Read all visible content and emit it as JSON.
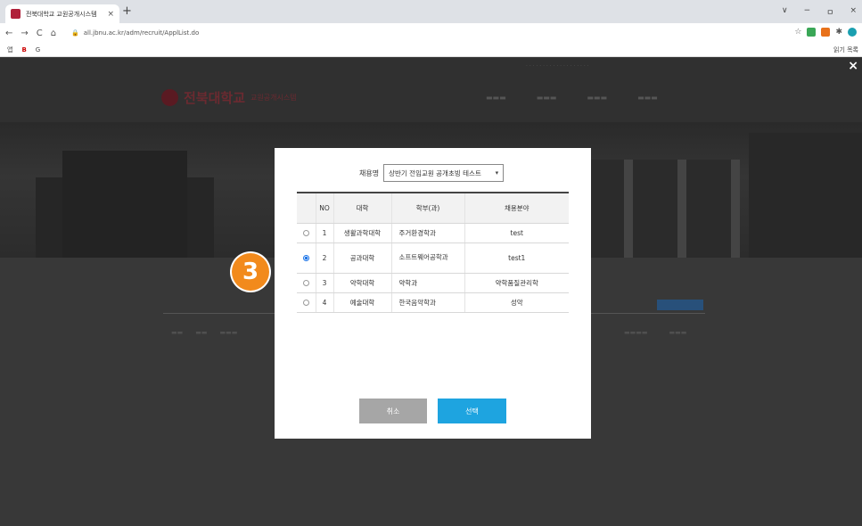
{
  "browser": {
    "tab_title": "전북대학교 교원공개시스템",
    "tab_close": "×",
    "new_tab": "+",
    "window_controls": [
      "∨",
      "−",
      "ㅁ",
      "×"
    ],
    "nav": [
      "←",
      "→",
      "C",
      "⌂"
    ],
    "url": "all.jbnu.ac.kr/adm/recruit/ApplList.do",
    "bookmarks": [
      "앱",
      "B",
      "G"
    ],
    "reading_list": "읽기 목록"
  },
  "page": {
    "university": "전북대학교",
    "system_name": "교원공개시스템",
    "close": "×"
  },
  "step_badge": "3",
  "modal": {
    "recruit_label": "채용명",
    "recruit_value": "상반기 전임교원 공개초빙 테스트",
    "table": {
      "headers": [
        "",
        "NO",
        "대학",
        "학부(과)",
        "채용분야"
      ],
      "rows": [
        {
          "selected": false,
          "no": "1",
          "college": "생활과학대학",
          "dept": "주거환경학과",
          "field": "test"
        },
        {
          "selected": true,
          "no": "2",
          "college": "공과대학",
          "dept": "소프트웨어공학과",
          "field": "test1"
        },
        {
          "selected": false,
          "no": "3",
          "college": "약학대학",
          "dept": "약학과",
          "field": "약학품질관리학"
        },
        {
          "selected": false,
          "no": "4",
          "college": "예술대학",
          "dept": "한국음악학과",
          "field": "성악"
        }
      ]
    },
    "cancel_label": "취소",
    "select_label": "선택"
  },
  "colors": {
    "accent": "#1ea4e0",
    "step_badge": "#f28a1c",
    "cancel_gray": "#a6a6a6"
  }
}
